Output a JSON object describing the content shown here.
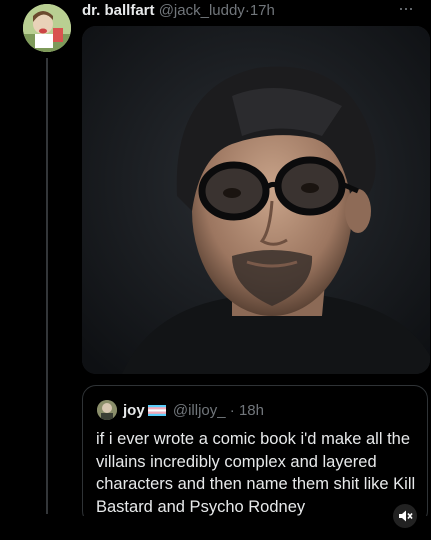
{
  "tweet": {
    "display_name": "dr. ballfart",
    "handle": "@jack_luddy",
    "separator": "·",
    "time": "17h",
    "more_label": "···"
  },
  "quoted_tweet": {
    "display_name": "joy",
    "handle": "@illjoy_",
    "separator": "·",
    "time": "18h",
    "text": "if i ever wrote a comic book i'd make all the villains incredibly complex and layered characters and then name them shit like Kill Bastard and Psycho Rodney"
  },
  "icons": {
    "more": "more-horizontal-icon",
    "mute": "mute-icon",
    "flag": "trans-flag-icon"
  },
  "colors": {
    "background": "#000000",
    "text": "#e7e9ea",
    "muted": "#71767b",
    "border": "#2f3336"
  }
}
